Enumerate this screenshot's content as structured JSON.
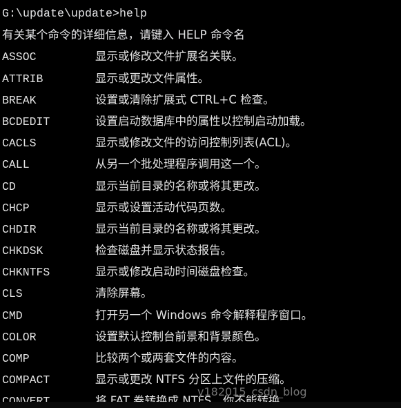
{
  "window": {
    "title": "G:\\update\\update>help",
    "background_color": "#000000",
    "text_color": "#e2e2e2"
  },
  "terminal": {
    "prompt_line": "G:\\update\\update>help",
    "intro_line": "有关某个命令的详细信息，请键入 HELP 命令名",
    "commands": [
      {
        "name": "ASSOC",
        "description": "显示或修改文件扩展名关联。"
      },
      {
        "name": "ATTRIB",
        "description": "显示或更改文件属性。"
      },
      {
        "name": "BREAK",
        "description": "设置或清除扩展式 CTRL+C 检查。"
      },
      {
        "name": "BCDEDIT",
        "description": "设置启动数据库中的属性以控制启动加载。"
      },
      {
        "name": "CACLS",
        "description": "显示或修改文件的访问控制列表(ACL)。"
      },
      {
        "name": "CALL",
        "description": "从另一个批处理程序调用这一个。"
      },
      {
        "name": "CD",
        "description": "显示当前目录的名称或将其更改。"
      },
      {
        "name": "CHCP",
        "description": "显示或设置活动代码页数。"
      },
      {
        "name": "CHDIR",
        "description": "显示当前目录的名称或将其更改。"
      },
      {
        "name": "CHKDSK",
        "description": "检查磁盘并显示状态报告。"
      },
      {
        "name": "CHKNTFS",
        "description": "显示或修改启动时间磁盘检查。"
      },
      {
        "name": "CLS",
        "description": "清除屏幕。"
      },
      {
        "name": "CMD",
        "description": "打开另一个 Windows 命令解释程序窗口。"
      },
      {
        "name": "COLOR",
        "description": "设置默认控制台前景和背景颜色。"
      },
      {
        "name": "COMP",
        "description": "比较两个或两套文件的内容。"
      },
      {
        "name": "COMPACT",
        "description": "显示或更改 NTFS 分区上文件的压缩。"
      },
      {
        "name": "CONVERT",
        "description": "将 FAT 卷转换成 NTFS。你不能转换"
      }
    ]
  },
  "watermark": {
    "text": "y182015_csdn_blog"
  }
}
